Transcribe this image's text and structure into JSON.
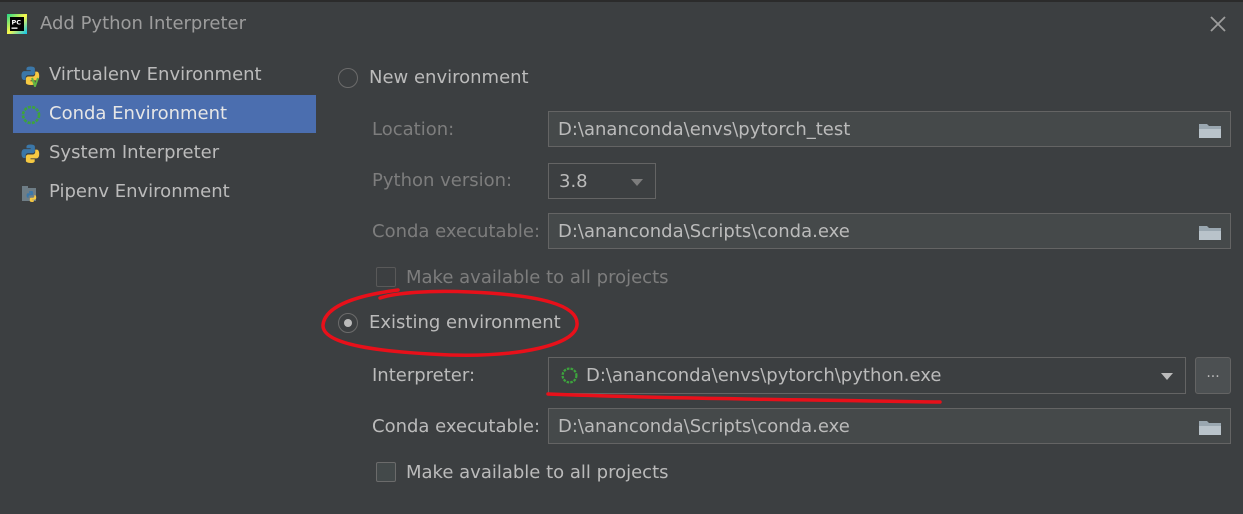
{
  "window": {
    "title": "Add Python Interpreter",
    "close_icon": "close-icon"
  },
  "sidebar": {
    "items": [
      {
        "label": "Virtualenv Environment",
        "icon": "virtualenv-icon",
        "selected": false
      },
      {
        "label": "Conda Environment",
        "icon": "conda-icon",
        "selected": true
      },
      {
        "label": "System Interpreter",
        "icon": "python-icon",
        "selected": false
      },
      {
        "label": "Pipenv Environment",
        "icon": "pipenv-icon",
        "selected": false
      }
    ]
  },
  "new_env": {
    "radio_label": "New environment",
    "selected": false,
    "location_label": "Location:",
    "location_value": "D:\\ananconda\\envs\\pytorch_test",
    "python_version_label": "Python version:",
    "python_version_value": "3.8",
    "conda_exec_label": "Conda executable:",
    "conda_exec_value": "D:\\ananconda\\Scripts\\conda.exe",
    "make_available_label": "Make available to all projects",
    "make_available_checked": false
  },
  "existing_env": {
    "radio_label": "Existing environment",
    "selected": true,
    "interpreter_label": "Interpreter:",
    "interpreter_value": "D:\\ananconda\\envs\\pytorch\\python.exe",
    "browse_label": "...",
    "conda_exec_label": "Conda executable:",
    "conda_exec_value": "D:\\ananconda\\Scripts\\conda.exe",
    "make_available_label": "Make available to all projects",
    "make_available_checked": false
  },
  "colors": {
    "background": "#3c3f41",
    "selection": "#4b6eaf",
    "annotation": "#e8101a",
    "conda_green": "#3da33d"
  }
}
